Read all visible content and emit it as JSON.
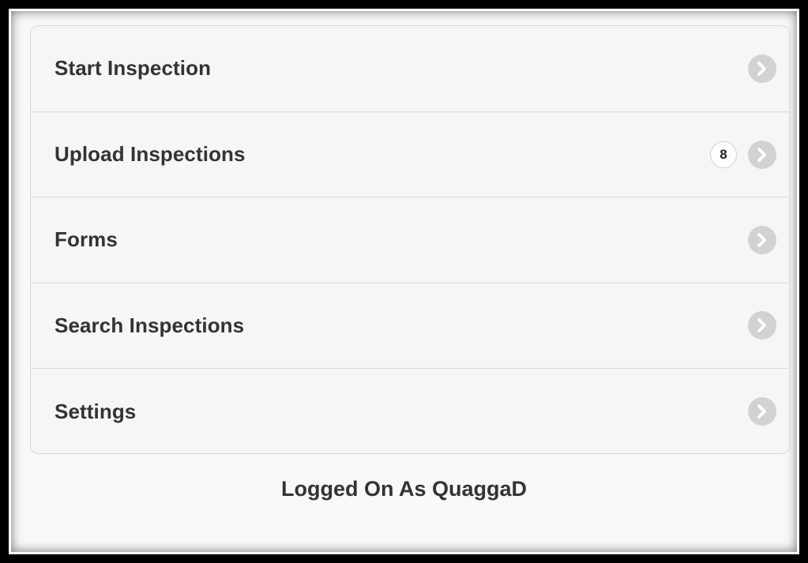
{
  "menu": {
    "items": [
      {
        "label": "Start Inspection",
        "icon": "chevron-right-icon"
      },
      {
        "label": "Upload Inspections",
        "badge": "8",
        "icon": "chevron-right-icon"
      },
      {
        "label": "Forms",
        "icon": "chevron-right-icon"
      },
      {
        "label": "Search Inspections",
        "icon": "chevron-right-icon"
      },
      {
        "label": "Settings",
        "icon": "chevron-right-icon"
      }
    ]
  },
  "footer": {
    "status_text": "Logged On As QuaggaD"
  },
  "colors": {
    "label_text": "#333333",
    "chevron_circle": "#d2d2d2",
    "list_background": "#f6f6f6"
  }
}
